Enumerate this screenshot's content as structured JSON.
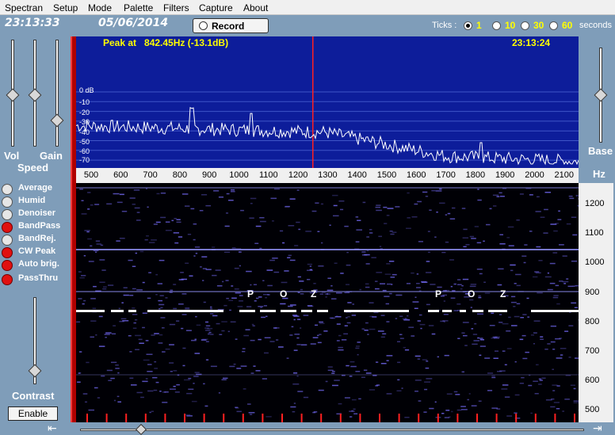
{
  "menu": [
    "Spectran",
    "Setup",
    "Mode",
    "Palette",
    "Filters",
    "Capture",
    "About"
  ],
  "header": {
    "time": "23:13:33",
    "date": "05/06/2014",
    "record_label": "Record",
    "ticks_label": "Ticks :",
    "tick_options": [
      "1",
      "10",
      "30",
      "60"
    ],
    "tick_selected": "1",
    "seconds_label": "seconds"
  },
  "left_panel": {
    "vol_label": "Vol",
    "gain_label": "Gain",
    "speed_label": "Speed",
    "sliders": [
      {
        "name": "vol",
        "level": 0.5
      },
      {
        "name": "gain",
        "level": 0.5
      },
      {
        "name": "speed",
        "level": 0.7
      }
    ],
    "filters": [
      {
        "label": "Average",
        "on": false
      },
      {
        "label": "Humid",
        "on": false
      },
      {
        "label": "Denoiser",
        "on": false
      },
      {
        "label": "BandPass",
        "on": true
      },
      {
        "label": "BandRej.",
        "on": false
      },
      {
        "label": "CW Peak",
        "on": true
      },
      {
        "label": "Auto brig.",
        "on": true
      },
      {
        "label": "PassThru",
        "on": true
      }
    ],
    "contrast_label": "Contrast",
    "contrast_level": 0.85,
    "enable_label": "Enable"
  },
  "spectrum": {
    "peak_text": "Peak at   842.45Hz (-13.1dB)",
    "time": "23:13:24",
    "db_labels": [
      "0 dB",
      "-10",
      "-20",
      "-30",
      "-40",
      "-50",
      "-60",
      "-70"
    ],
    "freq_labels": [
      "500",
      "600",
      "700",
      "800",
      "900",
      "1000",
      "1100",
      "1200",
      "1300",
      "1400",
      "1500",
      "1600",
      "1700",
      "1800",
      "1900",
      "2000",
      "2100"
    ],
    "marker_hz": 1250,
    "colors": {
      "bg": "#0d1d9a",
      "trace": "#ffffff",
      "marker": "#ff2020",
      "grid": "#3f55c8"
    }
  },
  "waterfall": {
    "decoded_left": [
      "P",
      "O",
      "Z"
    ],
    "decoded_right": [
      "P",
      "O",
      "Z"
    ],
    "right_labels": [
      "1200",
      "1100",
      "1000",
      "900",
      "800",
      "700",
      "600",
      "500"
    ]
  },
  "right_panel": {
    "base_label": "Base",
    "hz_label": "Hz",
    "base_level": 0.5
  }
}
